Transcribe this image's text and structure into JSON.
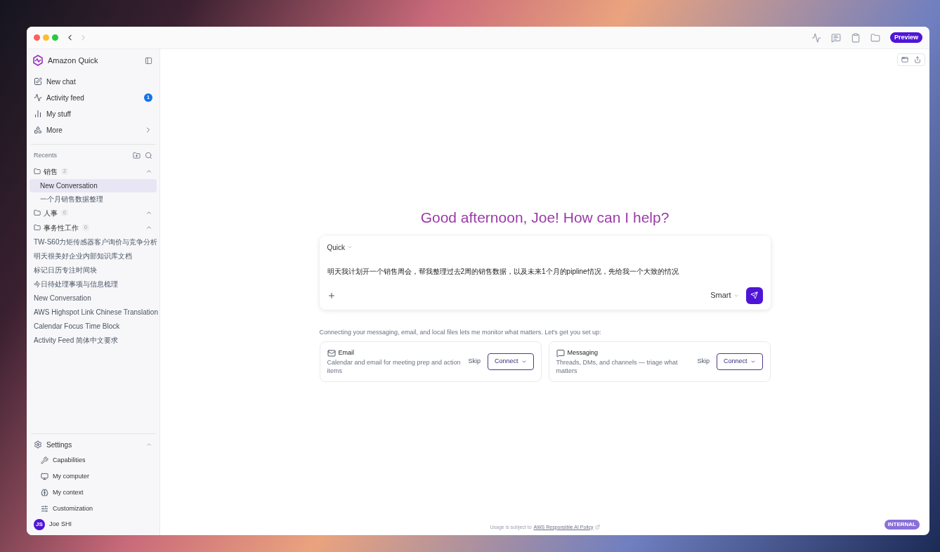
{
  "toolbar": {
    "badge": "Preview"
  },
  "sidebar": {
    "app_name": "Amazon Quick",
    "nav": [
      {
        "kind": "new-chat",
        "label": "New chat"
      },
      {
        "kind": "activity",
        "label": "Activity feed",
        "badge": "1"
      },
      {
        "kind": "stuff",
        "label": "My stuff"
      },
      {
        "kind": "more",
        "label": "More"
      }
    ],
    "recents_label": "Recents",
    "folders": [
      {
        "name": "销售",
        "count": "2",
        "expanded": true,
        "children": [
          {
            "label": "New Conversation",
            "selected": true
          },
          {
            "label": "一个月销售数据整理",
            "selected": false
          }
        ]
      },
      {
        "name": "人事",
        "count": "0",
        "expanded": true
      },
      {
        "name": "事务性工作",
        "count": "0",
        "expanded": true
      }
    ],
    "recent_chats": [
      {
        "label": "TW-S60力矩传感器客户询价与竞争分析",
        "selected": false
      },
      {
        "label": "明天很美好企业内部知识库文档",
        "selected": false
      },
      {
        "label": "标记日历专注时间块",
        "selected": false
      },
      {
        "label": "今日待处理事项与信息梳理",
        "selected": false
      },
      {
        "label": "New Conversation",
        "selected": false
      },
      {
        "label": "AWS Highspot Link Chinese Translation",
        "selected": false
      },
      {
        "label": "Calendar Focus Time Block",
        "selected": false
      },
      {
        "label": "Activity Feed 简体中文要求",
        "selected": false
      }
    ],
    "settings": {
      "label": "Settings",
      "expanded": true,
      "items": [
        {
          "kind": "capabilities",
          "label": "Capabilities"
        },
        {
          "kind": "computer",
          "label": "My computer"
        },
        {
          "kind": "context",
          "label": "My context"
        },
        {
          "kind": "customization",
          "label": "Customization"
        }
      ]
    },
    "user": {
      "initials": "JS",
      "name": "Joe SHI"
    }
  },
  "main": {
    "greeting": "Good afternoon, Joe! How can I help?",
    "composer": {
      "mode": "Quick",
      "value": "明天我计划开一个销售周会，帮我整理过去2周的销售数据，以及未来1个月的pipline情况，先给我一个大致的情况",
      "model": "Smart"
    },
    "setup_prompt": "Connecting your messaging, email, and local files lets me monitor what matters. Let's get you set up:",
    "connectors": [
      {
        "kind": "email",
        "title": "Email",
        "description": "Calendar and email for meeting prep and action items",
        "skip": "Skip",
        "connect": "Connect"
      },
      {
        "kind": "messaging",
        "title": "Messaging",
        "description": "Threads, DMs, and channels — triage what matters",
        "skip": "Skip",
        "connect": "Connect"
      }
    ],
    "footer": {
      "text": "Usage is subject to",
      "link": "AWS Responsible AI Policy"
    },
    "env_badge": "INTERNAL"
  }
}
